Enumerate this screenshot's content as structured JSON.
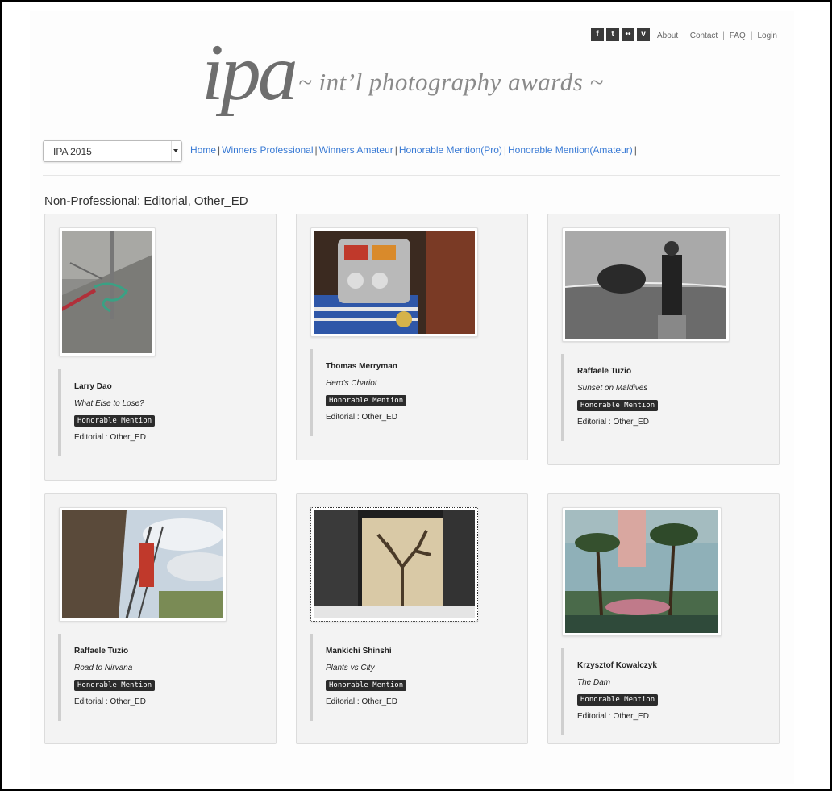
{
  "header": {
    "social": [
      {
        "label": "f",
        "icon": "facebook-icon"
      },
      {
        "label": "t",
        "icon": "tumblr-icon"
      },
      {
        "label": "••",
        "icon": "flickr-icon"
      },
      {
        "label": "v",
        "icon": "vimeo-icon"
      }
    ],
    "links": [
      "About",
      "Contact",
      "FAQ",
      "Login"
    ],
    "separator": "|",
    "logo_text": "ipa",
    "tagline": "~ int’l photography awards ~"
  },
  "toolbar": {
    "year_select_value": "IPA 2015",
    "nav": [
      "Home",
      "Winners Professional",
      "Winners Amateur",
      "Honorable Mention(Pro)",
      "Honorable Mention(Amateur)"
    ],
    "nav_separator": "|"
  },
  "section_title": "Non-Professional: Editorial, Other_ED",
  "entries": [
    {
      "name": "Larry Dao",
      "title": "What Else to Lose?",
      "badge": "Honorable Mention",
      "category": "Editorial : Other_ED"
    },
    {
      "name": "Thomas Merryman",
      "title": "Hero's Chariot",
      "badge": "Honorable Mention",
      "category": "Editorial : Other_ED"
    },
    {
      "name": "Raffaele Tuzio",
      "title": "Sunset on Maldives",
      "badge": "Honorable Mention",
      "category": "Editorial : Other_ED"
    },
    {
      "name": "Raffaele Tuzio",
      "title": "Road to Nirvana",
      "badge": "Honorable Mention",
      "category": "Editorial : Other_ED"
    },
    {
      "name": "Mankichi Shinshi",
      "title": "Plants vs City",
      "badge": "Honorable Mention",
      "category": "Editorial : Other_ED"
    },
    {
      "name": "Krzysztof Kowalczyk",
      "title": "The Dam",
      "badge": "Honorable Mention",
      "category": "Editorial : Other_ED"
    }
  ]
}
